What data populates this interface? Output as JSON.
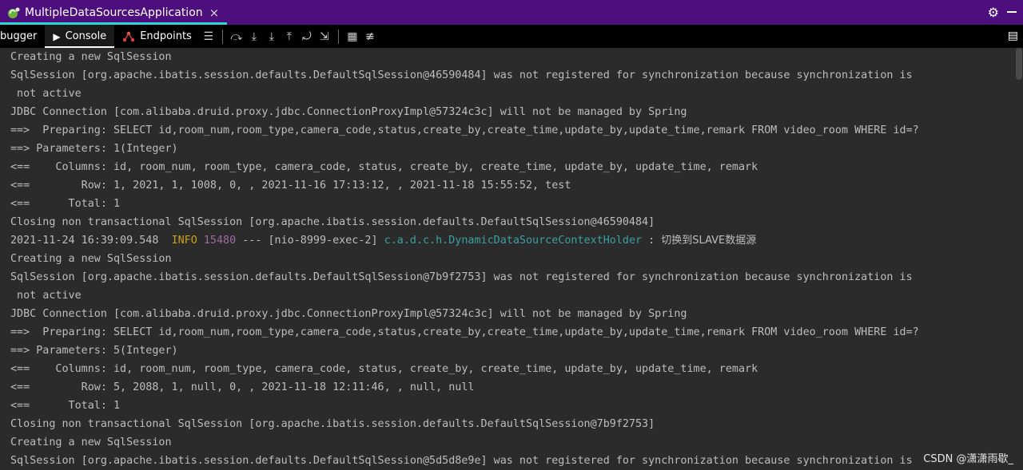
{
  "window": {
    "tab_title": "MultipleDataSourcesApplication",
    "tab_close": "×",
    "gear": "⚙"
  },
  "toolbar": {
    "tabs": [
      {
        "label": "bugger",
        "icon": ""
      },
      {
        "label": "Console",
        "icon": "▶"
      },
      {
        "label": "Endpoints",
        "icon": "⚙"
      }
    ]
  },
  "console": {
    "lines": [
      "Creating a new SqlSession",
      "SqlSession [org.apache.ibatis.session.defaults.DefaultSqlSession@46590484] was not registered for synchronization because synchronization is",
      " not active",
      "JDBC Connection [com.alibaba.druid.proxy.jdbc.ConnectionProxyImpl@57324c3c] will not be managed by Spring",
      "==>  Preparing: SELECT id,room_num,room_type,camera_code,status,create_by,create_time,update_by,update_time,remark FROM video_room WHERE id=?",
      "==> Parameters: 1(Integer)",
      "<==    Columns: id, room_num, room_type, camera_code, status, create_by, create_time, update_by, update_time, remark",
      "<==        Row: 1, 2021, 1, 1008, 0, , 2021-11-16 17:13:12, , 2021-11-18 15:55:52, test",
      "<==      Total: 1",
      "Closing non transactional SqlSession [org.apache.ibatis.session.defaults.DefaultSqlSession@46590484]"
    ],
    "log_line": {
      "timestamp": "2021-11-24 16:39:09.548",
      "level": "INFO",
      "pid": "15480",
      "separator": "---",
      "thread": "[nio-8999-exec-2]",
      "logger": "c.a.d.c.h.DynamicDataSourceContextHolder",
      "colon": ":",
      "message": "切换到SLAVE数据源"
    },
    "lines2": [
      "Creating a new SqlSession",
      "SqlSession [org.apache.ibatis.session.defaults.DefaultSqlSession@7b9f2753] was not registered for synchronization because synchronization is",
      " not active",
      "JDBC Connection [com.alibaba.druid.proxy.jdbc.ConnectionProxyImpl@57324c3c] will not be managed by Spring",
      "==>  Preparing: SELECT id,room_num,room_type,camera_code,status,create_by,create_time,update_by,update_time,remark FROM video_room WHERE id=?",
      "==> Parameters: 5(Integer)",
      "<==    Columns: id, room_num, room_type, camera_code, status, create_by, create_time, update_by, update_time, remark",
      "<==        Row: 5, 2088, 1, null, 0, , 2021-11-18 12:11:46, , null, null",
      "<==      Total: 1",
      "Closing non transactional SqlSession [org.apache.ibatis.session.defaults.DefaultSqlSession@7b9f2753]",
      "Creating a new SqlSession",
      "SqlSession [org.apache.ibatis.session.defaults.DefaultSqlSession@5d5d8e9e] was not registered for synchronization because synchronization is"
    ]
  },
  "watermark": "CSDN @潇潇雨歇_",
  "colors": {
    "titlebar": "#4d0f7e",
    "tab_underline": "#2bd7d7",
    "console_bg": "#2b2b2b",
    "info": "#c7a21b",
    "logger": "#3aa0a0"
  }
}
